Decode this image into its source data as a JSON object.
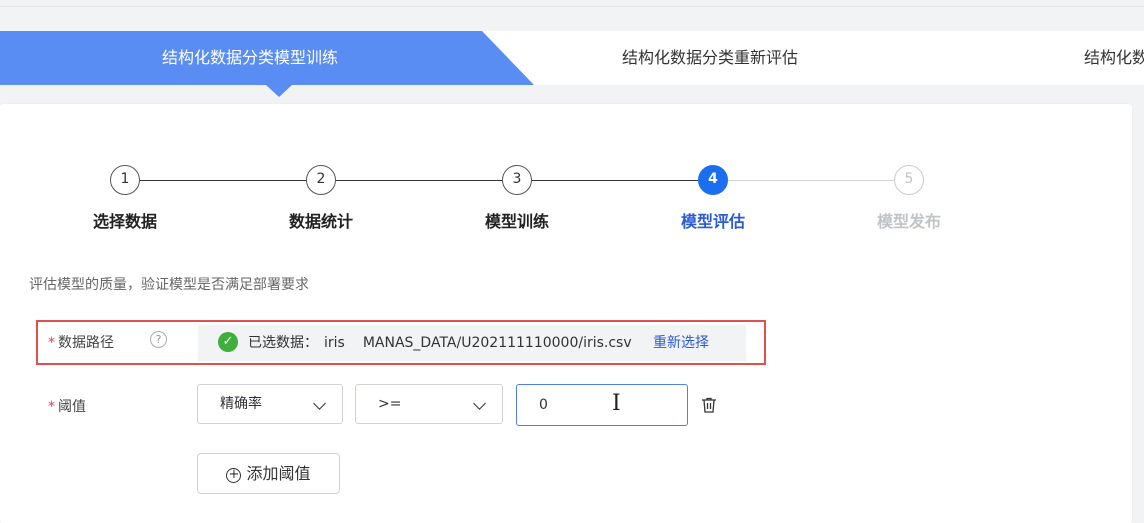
{
  "tabs": [
    {
      "label": "结构化数据分类模型训练",
      "active": true
    },
    {
      "label": "结构化数据分类重新评估",
      "active": false
    },
    {
      "label": "结构化数",
      "active": false
    }
  ],
  "steps": [
    {
      "number": "1",
      "label": "选择数据",
      "state": "done"
    },
    {
      "number": "2",
      "label": "数据统计",
      "state": "done"
    },
    {
      "number": "3",
      "label": "模型训练",
      "state": "done"
    },
    {
      "number": "4",
      "label": "模型评估",
      "state": "active"
    },
    {
      "number": "5",
      "label": "模型发布",
      "state": "todo"
    }
  ],
  "description": "评估模型的质量，验证模型是否满足部署要求",
  "data_path": {
    "label": "数据路径",
    "required_mark": "*",
    "help_icon": "question-circle-icon",
    "selected_prefix": "已选数据：",
    "dataset_name": "iris",
    "path": "MANAS_DATA/U202111110000/iris.csv",
    "reselect_label": "重新选择"
  },
  "threshold": {
    "label": "阈值",
    "required_mark": "*",
    "metric": "精确率",
    "operator": ">=",
    "value": "0",
    "add_button_label": "添加阈值"
  },
  "colors": {
    "accent": "#5a8df3",
    "primary": "#1b6ef0",
    "link": "#2a5bd7",
    "success": "#3fae3a",
    "required": "#e8453c",
    "annotation": "#e05050"
  }
}
